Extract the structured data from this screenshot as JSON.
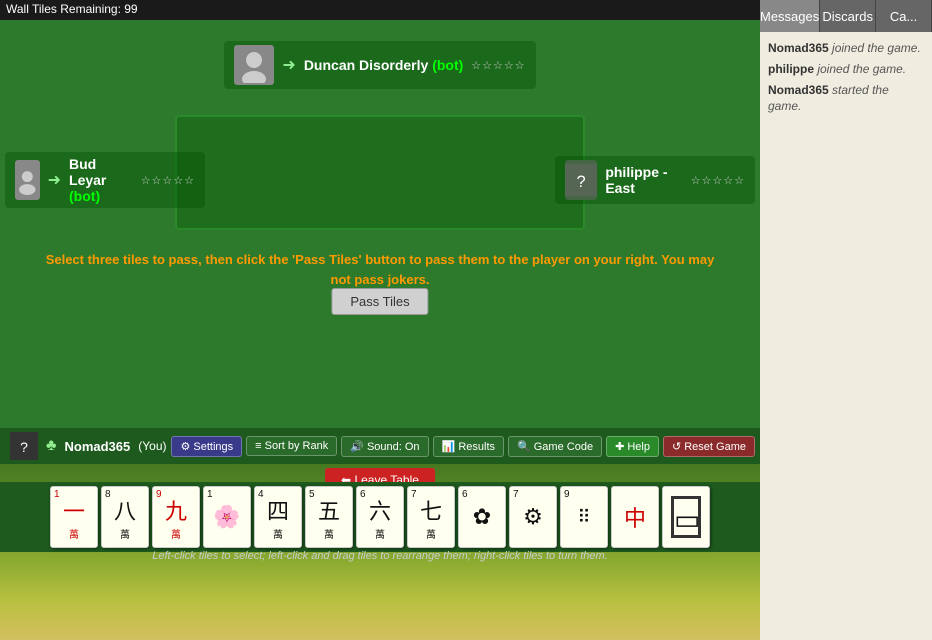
{
  "topBar": {
    "text": "Wall Tiles Remaining: 99"
  },
  "tabs": [
    {
      "id": "messages",
      "label": "Messages",
      "active": true
    },
    {
      "id": "discards",
      "label": "Discards",
      "active": false
    },
    {
      "id": "can",
      "label": "Ca...",
      "active": false
    }
  ],
  "chat": {
    "messages": [
      {
        "name": "Nomad365",
        "action": "joined the game."
      },
      {
        "name": "philippe",
        "action": "joined the game."
      },
      {
        "name": "Nomad365",
        "action": "started the game."
      }
    ]
  },
  "players": {
    "north": {
      "name": "Duncan Disorderly",
      "tag": "(bot)",
      "direction": "→",
      "stars": "☆☆☆☆☆"
    },
    "west": {
      "name": "Bud Leyar",
      "tag": "(bot)",
      "direction": "→",
      "stars": "☆☆☆☆☆"
    },
    "east": {
      "name": "philippe - East",
      "stars": "☆☆☆☆☆"
    },
    "south": {
      "name": "Nomad365",
      "tag": "(You)",
      "direction": "♣",
      "stars": "☆☆☆☆☆"
    }
  },
  "instruction": {
    "line1": "Select three tiles to pass, then click the 'Pass Tiles' button to pass them to the player on your right. You may",
    "line2": "not pass jokers."
  },
  "buttons": {
    "passTiles": "Pass Tiles",
    "leaveTable": "⬅ Leave Table",
    "settings": "⚙ Settings",
    "sortByRank": "≡ Sort by Rank",
    "sound": "🔊 Sound: On",
    "results": "📊 Results",
    "gameCode": "🔍 Game Code",
    "help": "✚ Help",
    "resetGame": "↺ Reset Game"
  },
  "tiles": [
    {
      "top": "1",
      "main": "一",
      "sub": "萬",
      "color": "red"
    },
    {
      "top": "8",
      "main": "八",
      "sub": "萬",
      "color": "black"
    },
    {
      "top": "9",
      "main": "九",
      "sub": "萬",
      "color": "red"
    },
    {
      "top": "1",
      "main": "🌸",
      "sub": "",
      "color": "black"
    },
    {
      "top": "4",
      "main": "四",
      "sub": "萬",
      "color": "black"
    },
    {
      "top": "5",
      "main": "五",
      "sub": "萬",
      "color": "black"
    },
    {
      "top": "6",
      "main": "六",
      "sub": "萬",
      "color": "black"
    },
    {
      "top": "7",
      "main": "七",
      "sub": "萬",
      "color": "black"
    },
    {
      "top": "6",
      "main": "✿",
      "sub": "",
      "color": "black"
    },
    {
      "top": "7",
      "main": "⚙",
      "sub": "",
      "color": "black"
    },
    {
      "top": "9",
      "main": "⠿",
      "sub": "",
      "color": "black"
    },
    {
      "top": "",
      "main": "中",
      "sub": "",
      "color": "red"
    },
    {
      "top": "",
      "main": "☐",
      "sub": "",
      "color": "black"
    }
  ],
  "hint": "Left-click tiles to select; left-click and drag tiles to rearrange them; right-click tiles to turn them.",
  "colors": {
    "accent": "#00cc00",
    "danger": "#cc2222",
    "board": "#2d7a2d"
  }
}
